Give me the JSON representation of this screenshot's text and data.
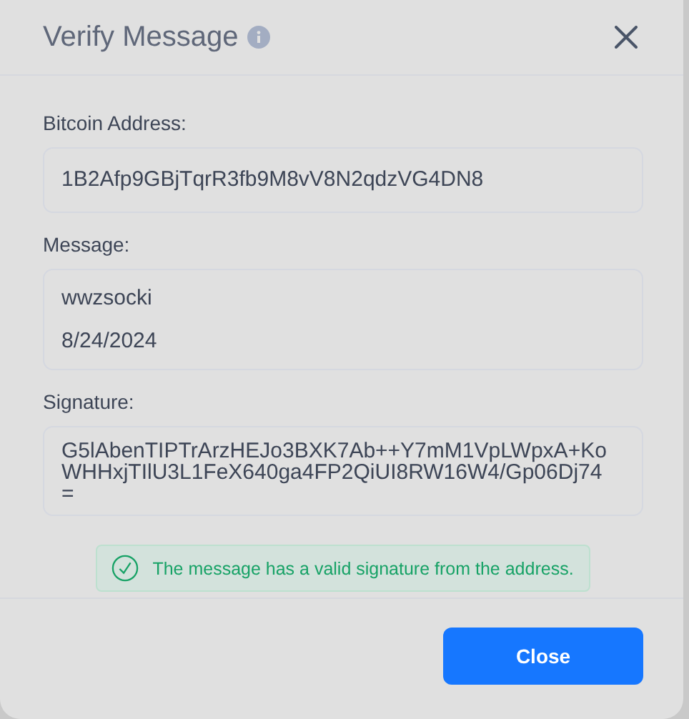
{
  "dialog": {
    "title": "Verify Message"
  },
  "fields": [
    {
      "label": "Bitcoin Address:",
      "value": "1B2Afp9GBjTqrR3fb9M8vV8N2qdzVG4DN8"
    },
    {
      "label": "Message:",
      "value": "wwzsocki\n\n8/24/2024"
    },
    {
      "label": "Signature:",
      "value": "G5lAbenTIPTrArzHEJo3BXK7Ab++Y7mM1VpLWpxA+KoWHHxjTIlU3L1FeX640ga4FP2QiUI8RW16W4/Gp06Dj74="
    }
  ],
  "result": {
    "kind": "success",
    "text": "The message has a valid signature from the address."
  },
  "buttons": [
    "Close"
  ]
}
